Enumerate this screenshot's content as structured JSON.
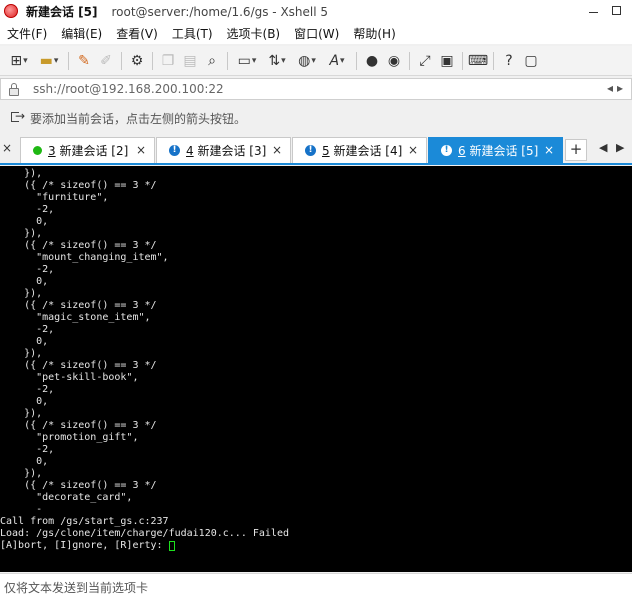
{
  "window": {
    "title_bold": "新建会话 [5]",
    "title_rest": "root@server:/home/1.6/gs - Xshell 5"
  },
  "menu": [
    "文件(F)",
    "编辑(E)",
    "查看(V)",
    "工具(T)",
    "选项卡(B)",
    "窗口(W)",
    "帮助(H)"
  ],
  "toolbar": {
    "icons": [
      "new-session-icon",
      "open-folder-icon",
      "reconnect-icon",
      "disconnect-icon",
      "properties-icon",
      "copy-icon",
      "paste-icon",
      "find-icon",
      "print-icon",
      "transfer-icon",
      "globe-icon",
      "font-icon",
      "xftp-icon",
      "xmanager-icon",
      "fullscreen-icon",
      "lock-icon",
      "keyboard-icon",
      "help-icon",
      "chat-icon"
    ]
  },
  "address": {
    "value": "ssh://root@192.168.200.100:22"
  },
  "hint": {
    "text": "要添加当前会话，点击左侧的箭头按钮。"
  },
  "tabs": [
    {
      "number": "3",
      "label": "新建会话 [2]",
      "status": "connected",
      "active": false
    },
    {
      "number": "4",
      "label": "新建会话 [3]",
      "status": "alert",
      "active": false
    },
    {
      "number": "5",
      "label": "新建会话 [4]",
      "status": "alert",
      "active": false
    },
    {
      "number": "6",
      "label": "新建会话 [5]",
      "status": "alert",
      "active": true
    }
  ],
  "tab_controls": {
    "add": "+",
    "left": "◀",
    "right": "▶",
    "close": "×"
  },
  "terminal": {
    "lines": [
      "    }),",
      "    ({ /* sizeof() == 3 */",
      "      \"furniture\",",
      "      -2,",
      "      0,",
      "    }),",
      "    ({ /* sizeof() == 3 */",
      "      \"mount_changing_item\",",
      "      -2,",
      "      0,",
      "    }),",
      "    ({ /* sizeof() == 3 */",
      "      \"magic_stone_item\",",
      "      -2,",
      "      0,",
      "    }),",
      "    ({ /* sizeof() == 3 */",
      "      \"pet-skill-book\",",
      "      -2,",
      "      0,",
      "    }),",
      "    ({ /* sizeof() == 3 */",
      "      \"promotion_gift\",",
      "      -2,",
      "      0,",
      "    }),",
      "    ({ /* sizeof() == 3 */",
      "      \"decorate_card\",",
      "      -",
      "Call from /gs/start_gs.c:237",
      "Load: /gs/clone/item/charge/fudai120.c... Failed",
      "[A]bort, [I]gnore, [R]erty: "
    ]
  },
  "sendbar": {
    "placeholder": "仅将文本发送到当前选项卡"
  }
}
